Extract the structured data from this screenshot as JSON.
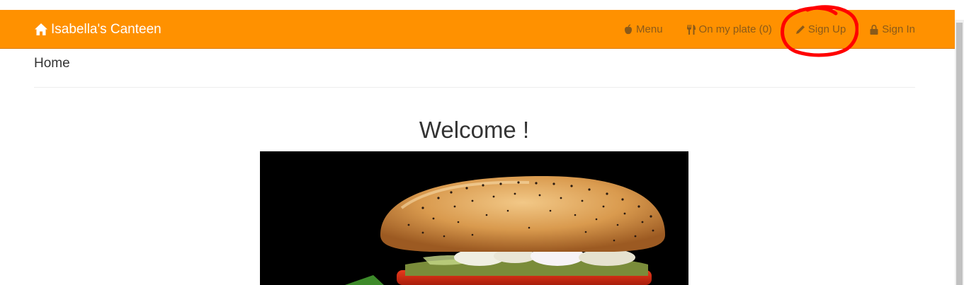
{
  "navbar": {
    "brand": "Isabella's Canteen",
    "brand_icon": "home-icon",
    "background": "#ff9100",
    "links": [
      {
        "label": "Menu",
        "icon": "apple-icon"
      },
      {
        "label": "On my plate (0)",
        "icon": "fork-knife-icon"
      },
      {
        "label": "Sign Up",
        "icon": "pencil-icon"
      },
      {
        "label": "Sign In",
        "icon": "lock-icon"
      }
    ]
  },
  "breadcrumb": {
    "current": "Home"
  },
  "main": {
    "heading": "Welcome !",
    "hero_image": "burger-photo"
  },
  "annotation": {
    "color": "#ff0000",
    "target": "Sign Up"
  }
}
